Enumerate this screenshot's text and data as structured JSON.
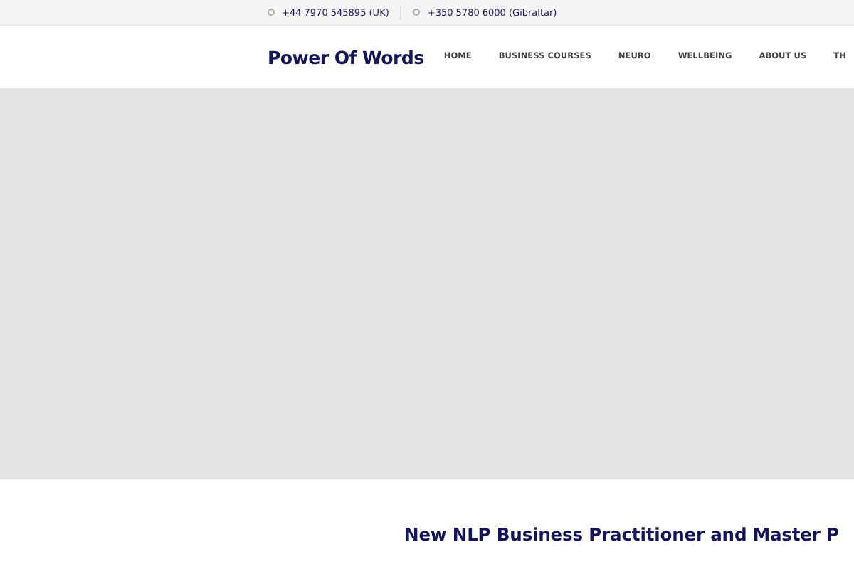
{
  "top_bar": {
    "phones": [
      "+44 7970 545895 (UK)",
      "+350 5780 6000 (Gibraltar)"
    ]
  },
  "header": {
    "logo": "Power Of Words",
    "nav": [
      "HOME",
      "BUSINESS COURSES",
      "NEURO",
      "WELLBEING",
      "ABOUT US",
      "TH"
    ]
  },
  "heading": "New NLP Business Practitioner and Master P"
}
